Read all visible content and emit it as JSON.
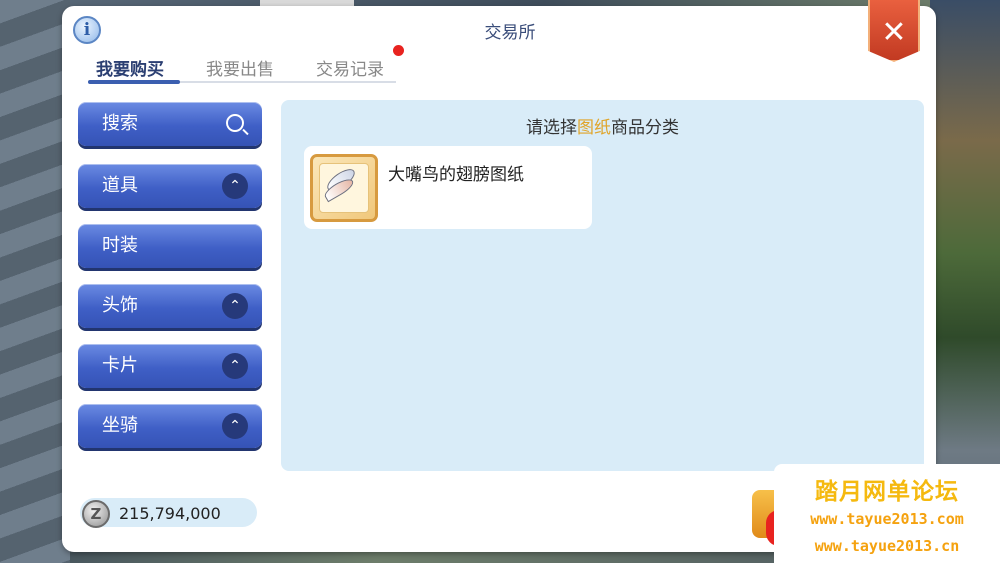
{
  "window": {
    "title": "交易所",
    "info_label": "i",
    "close_label": "✕"
  },
  "tabs": [
    {
      "label": "我要购买",
      "active": true
    },
    {
      "label": "我要出售",
      "active": false
    },
    {
      "label": "交易记录",
      "active": false,
      "notification_dot": true
    }
  ],
  "sidebar": {
    "items": [
      {
        "label": "搜索",
        "icon": "search-icon"
      },
      {
        "label": "道具",
        "icon": "chevron-up-icon"
      },
      {
        "label": "时装",
        "icon": null
      },
      {
        "label": "头饰",
        "icon": "chevron-up-icon"
      },
      {
        "label": "卡片",
        "icon": "chevron-up-icon"
      },
      {
        "label": "坐骑",
        "icon": "chevron-up-icon"
      }
    ],
    "chevron_glyph": "⌃"
  },
  "content": {
    "prompt_before": "请选择",
    "prompt_highlight": "图纸",
    "prompt_after": "商品分类",
    "items": [
      {
        "name": "大嘴鸟的翅膀图纸",
        "icon": "wing-blueprint-icon"
      }
    ]
  },
  "wallet": {
    "coin_symbol": "Z",
    "amount": "215,794,000"
  },
  "watermark": {
    "title": "踏月网单论坛",
    "url1": "www.tayue2013.com",
    "url2": "www.tayue2013.cn"
  },
  "colors": {
    "accent": "#3b5fb0",
    "highlight": "#e0a52a",
    "close_button": "#d94a2e",
    "notification": "#e8231f"
  }
}
